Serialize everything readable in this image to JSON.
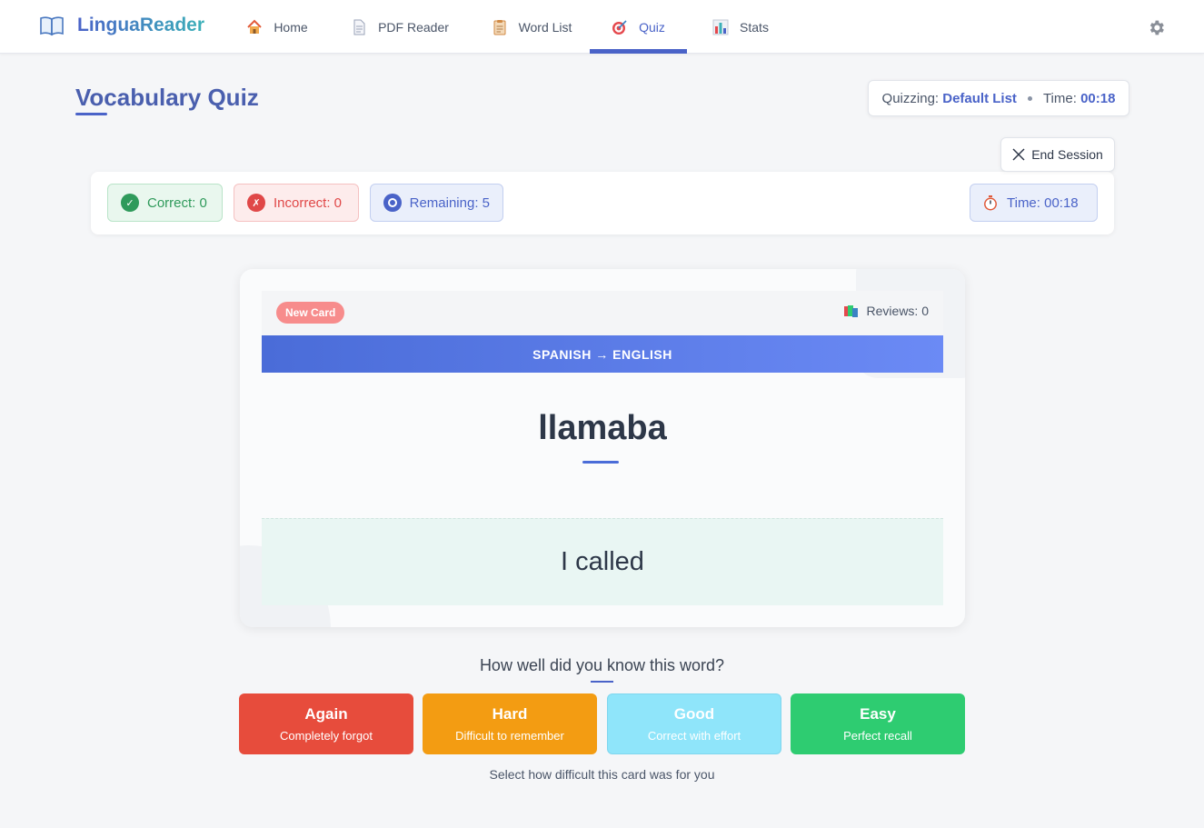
{
  "app": {
    "brand": "LinguaReader"
  },
  "nav": {
    "tabs": [
      {
        "label": "Home",
        "icon": "house-icon"
      },
      {
        "label": "PDF Reader",
        "icon": "document-icon"
      },
      {
        "label": "Word List",
        "icon": "clipboard-icon"
      },
      {
        "label": "Quiz",
        "icon": "target-icon",
        "active": true
      },
      {
        "label": "Stats",
        "icon": "bar-chart-icon"
      }
    ]
  },
  "header": {
    "title": "Vocabulary Quiz",
    "quizzing_label": "Quizzing:",
    "list_name": "Default List",
    "time_label": "Time:",
    "time_value": "00:18",
    "end_session": "End Session"
  },
  "stats": {
    "correct": "Correct: 0",
    "incorrect": "Incorrect: 0",
    "remaining": "Remaining: 5",
    "time": "Time: 00:18"
  },
  "card": {
    "badge": "New Card",
    "reviews": "Reviews: 0",
    "direction": "SPANISH → ENGLISH",
    "word": "llamaba",
    "answer": "I called"
  },
  "rating": {
    "question": "How well did you know this word?",
    "buttons": [
      {
        "title": "Again",
        "subtitle": "Completely forgot",
        "color": "#e74c3c"
      },
      {
        "title": "Hard",
        "subtitle": "Difficult to remember",
        "color": "#f39c12"
      },
      {
        "title": "Good",
        "subtitle": "Correct with effort",
        "color": "#8fe5fa"
      },
      {
        "title": "Easy",
        "subtitle": "Perfect recall",
        "color": "#2ecc71"
      }
    ],
    "hint": "Select how difficult this card was for you"
  },
  "colors": {
    "accent": "#4a63c8",
    "correct": "#2f9a5b",
    "incorrect": "#e04848"
  }
}
